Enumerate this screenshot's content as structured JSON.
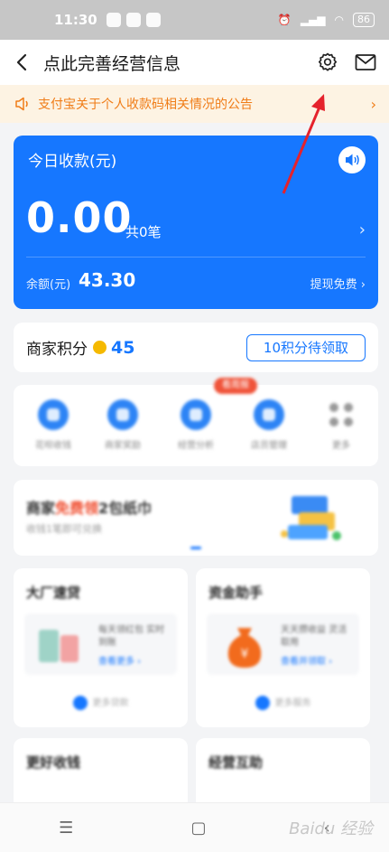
{
  "status_bar": {
    "time": "11:30",
    "battery": "86"
  },
  "header": {
    "title": "点此完善经营信息"
  },
  "notice": {
    "text": "支付宝关于个人收款码相关情况的公告",
    "color": "#f07c17"
  },
  "income": {
    "label": "今日收款(元)",
    "amount": "0.00",
    "count": "共0笔",
    "balance_label": "余额(元)",
    "balance_value": "43.30",
    "withdraw": "提现免费",
    "accent": "#1677ff"
  },
  "points": {
    "label": "商家积分",
    "value": "45",
    "claim_button": "10积分待领取"
  },
  "shortcuts": {
    "badge": "看周报",
    "items": [
      {
        "label": "花呗收钱",
        "icon": "huabei-icon"
      },
      {
        "label": "商家奖励",
        "icon": "reward-icon"
      },
      {
        "label": "经营分析",
        "icon": "analysis-icon"
      },
      {
        "label": "店员管理",
        "icon": "staff-icon"
      },
      {
        "label": "更多",
        "icon": "more-grid-icon"
      }
    ]
  },
  "promo": {
    "title_prefix": "商家",
    "title_highlight": "免费领",
    "title_suffix": "2包纸巾",
    "subtitle": "收钱1笔即可兑换"
  },
  "tiles": [
    {
      "title": "大厂速贷",
      "desc": "每天领红包 实时到账",
      "link": "查看更多 ›",
      "more": "更多贷款"
    },
    {
      "title": "资金助手",
      "desc": "天天攒收益 灵活取用",
      "link": "查看并领取 ›",
      "more": "更多服务"
    },
    {
      "title": "更好收钱",
      "desc": "",
      "link": "",
      "more": ""
    },
    {
      "title": "经营互助",
      "desc": "",
      "link": "",
      "more": ""
    }
  ],
  "watermark": "Baidu 经验"
}
